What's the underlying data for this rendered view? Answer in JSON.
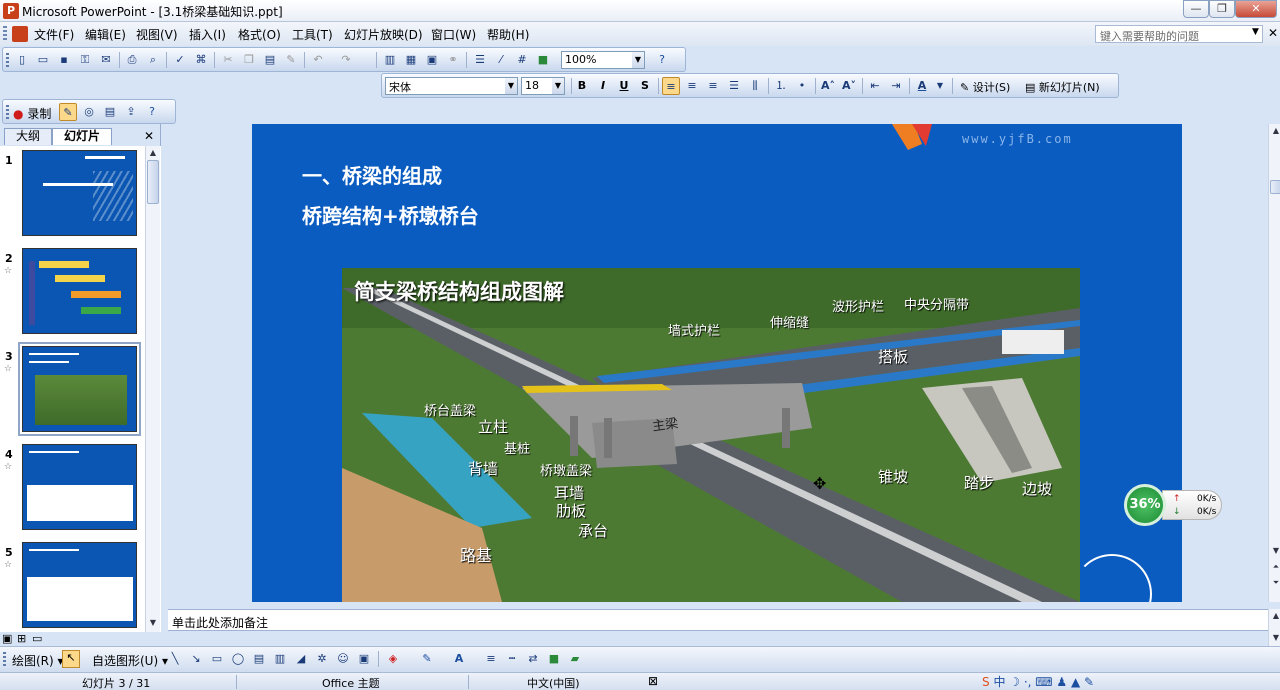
{
  "window": {
    "title": "Microsoft PowerPoint - [3.1桥梁基础知识.ppt]",
    "minimize": "—",
    "restore": "❐",
    "close": "✕"
  },
  "menu": {
    "items": [
      "文件(F)",
      "编辑(E)",
      "视图(V)",
      "插入(I)",
      "格式(O)",
      "工具(T)",
      "幻灯片放映(D)",
      "窗口(W)",
      "帮助(H)"
    ],
    "help_placeholder": "键入需要帮助的问题"
  },
  "standard_toolbar": {
    "zoom": "100%"
  },
  "format_toolbar": {
    "font": "宋体",
    "size": "18",
    "bold": "B",
    "italic": "I",
    "underline": "U",
    "shadow": "S",
    "design": "设计(S)",
    "new_slide": "新幻灯片(N)"
  },
  "record_toolbar": {
    "record": "录制"
  },
  "left_panel": {
    "tabs": [
      "大纲",
      "幻灯片"
    ],
    "close": "✕",
    "slides": [
      {
        "num": "1"
      },
      {
        "num": "2"
      },
      {
        "num": "3"
      },
      {
        "num": "4"
      },
      {
        "num": "5"
      }
    ]
  },
  "slide": {
    "website": "www.yjfB.com",
    "heading1": "一、桥梁的组成",
    "heading2": "桥跨结构+桥墩桥台",
    "image_title": "简支梁桥结构组成图解",
    "labels": [
      "墙式护栏",
      "伸缩缝",
      "波形护栏",
      "中央分隔带",
      "搭板",
      "桥台盖梁",
      "立柱",
      "基桩",
      "背墙",
      "桥墩盖梁",
      "耳墙",
      "肋板",
      "承台",
      "路基",
      "锥坡",
      "踏步",
      "边坡",
      "主梁"
    ]
  },
  "notes": {
    "placeholder": "单击此处添加备注"
  },
  "draw_toolbar": {
    "draw": "绘图(R)",
    "autoshapes": "自选图形(U)"
  },
  "status": {
    "slide_info": "幻灯片 3 / 31",
    "theme": "Office 主题",
    "language": "中文(中国)"
  },
  "net_widget": {
    "percent": "36%",
    "up": "0K/s",
    "down": "0K/s"
  },
  "colors": {
    "slide_bg": "#0a5cc0",
    "ui_bg": "#d7e4f5"
  }
}
